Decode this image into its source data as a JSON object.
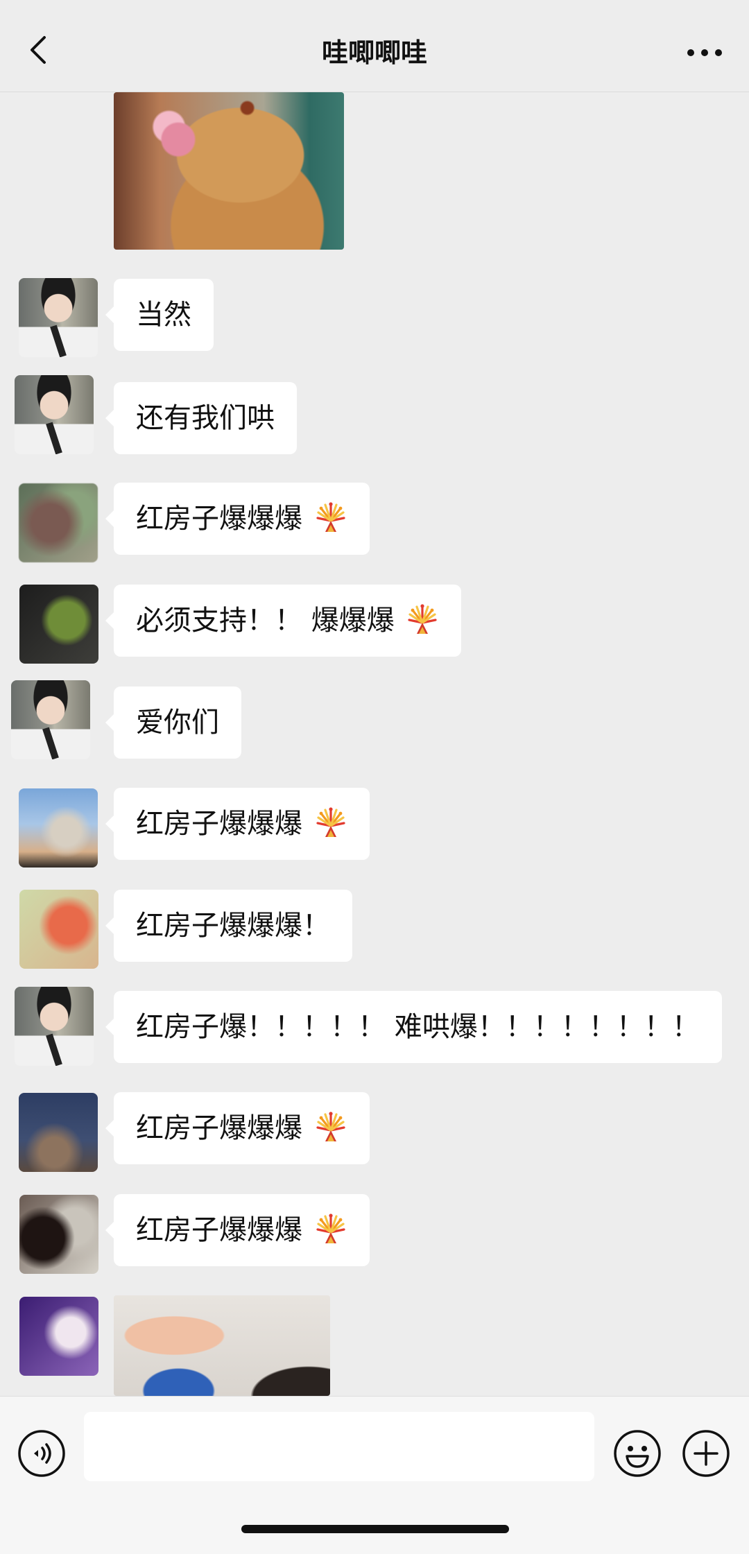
{
  "header": {
    "title": "哇唧唧哇",
    "back_icon": "chevron-left-icon",
    "more_icon": "more-dots-icon"
  },
  "messages": [
    {
      "type": "image",
      "content": "teddy-bear-with-rose-photo"
    },
    {
      "type": "text",
      "text": "当然"
    },
    {
      "type": "text",
      "text": "还有我们哄"
    },
    {
      "type": "text",
      "text": "红房子爆爆爆",
      "emoji": "fireworks-icon"
    },
    {
      "type": "text",
      "text": "必须支持！！ 爆爆爆",
      "emoji": "fireworks-icon"
    },
    {
      "type": "text",
      "text": "爱你们"
    },
    {
      "type": "text",
      "text": "红房子爆爆爆",
      "emoji": "fireworks-icon"
    },
    {
      "type": "text",
      "text": "红房子爆爆爆！"
    },
    {
      "type": "text",
      "text": "红房子爆！！！！！ 难哄爆！！！！！！！！"
    },
    {
      "type": "text",
      "text": "红房子爆爆爆",
      "emoji": "fireworks-icon"
    },
    {
      "type": "text",
      "text": "红房子爆爆爆",
      "emoji": "fireworks-icon"
    },
    {
      "type": "image",
      "content": "raised-fist-photo"
    }
  ],
  "input_bar": {
    "text_value": "",
    "voice_icon": "voice-input-icon",
    "emoji_icon": "emoji-smile-icon",
    "plus_icon": "plus-circle-icon"
  },
  "colors": {
    "background": "#ededed",
    "bubble": "#ffffff",
    "text": "#111111"
  }
}
